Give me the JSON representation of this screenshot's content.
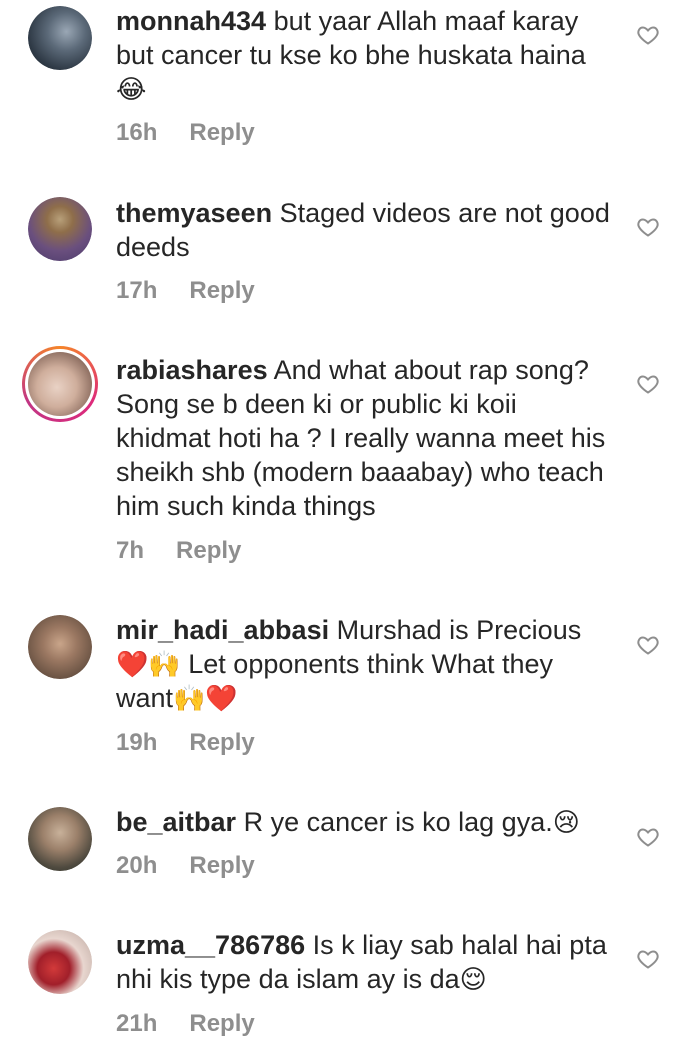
{
  "comments": [
    {
      "username": "monnah434",
      "text": "but yaar Allah maaf karay but cancer tu kse ko bhe huskata haina",
      "emoji": "😂",
      "time": "16h",
      "reply": "Reply"
    },
    {
      "username": "themyaseen",
      "text": "Staged videos are not good deeds",
      "time": "17h",
      "reply": "Reply"
    },
    {
      "username": "rabiashares",
      "text": "And what about rap song? Song se b deen ki or public ki koii khidmat hoti ha ? I really wanna meet his sheikh shb (modern baaabay) who teach him such kinda things",
      "time": "7h",
      "reply": "Reply"
    },
    {
      "username": "mir_hadi_abbasi",
      "text_a": "Murshad is Precious",
      "emoji_a": "❤️🙌",
      "text_b": "Let opponents think What they want",
      "emoji_b": "🙌❤️",
      "time": "19h",
      "reply": "Reply"
    },
    {
      "username": "be_aitbar",
      "text": "R ye cancer is ko lag gya.",
      "emoji": "😢",
      "time": "20h",
      "reply": "Reply"
    },
    {
      "username": "uzma__786786",
      "text": "Is k liay sab halal hai pta nhi kis type da islam ay is da",
      "emoji": "😌",
      "time": "21h",
      "reply": "Reply"
    }
  ],
  "icons": {
    "like": "heart-outline-icon"
  },
  "colors": {
    "text": "#262626",
    "meta": "#8e8e8e",
    "heart": "#8e8e8e"
  }
}
